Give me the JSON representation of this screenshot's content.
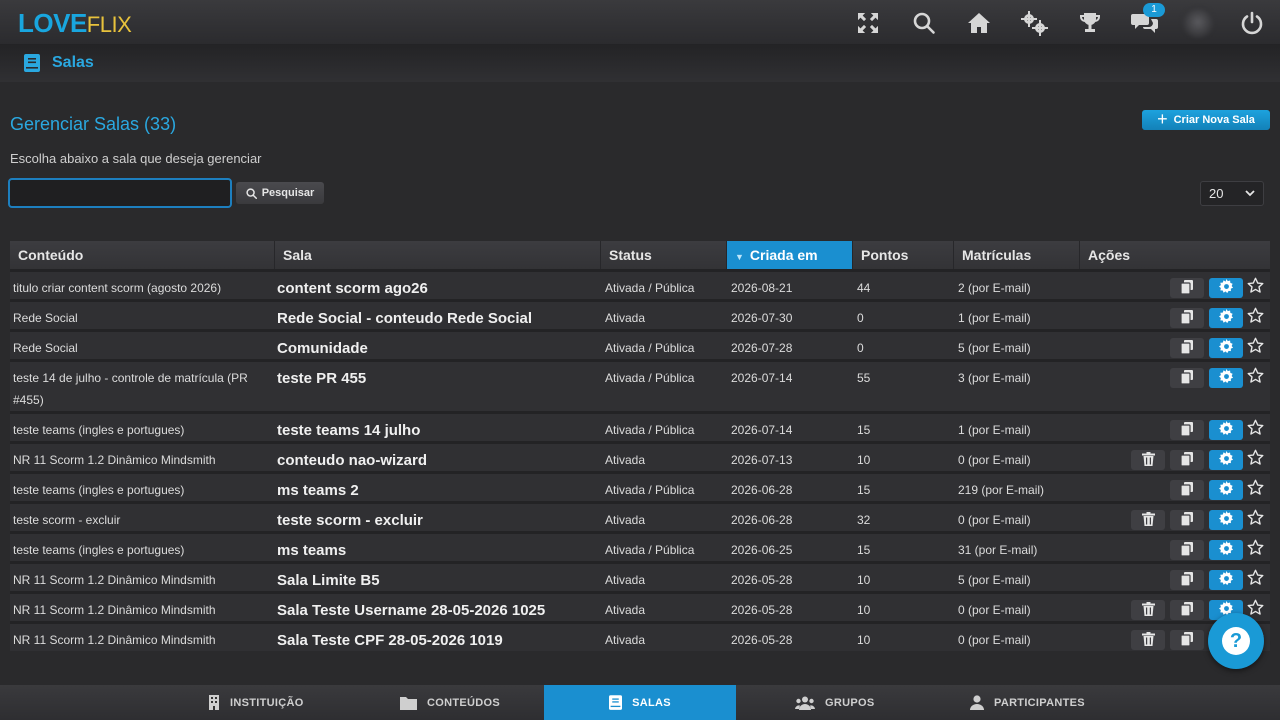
{
  "brand": {
    "part1": "LOVE",
    "part2": "FLIX"
  },
  "topbar": {
    "icons": [
      "expand-icon",
      "search-icon",
      "home-icon",
      "settings-icon",
      "trophy-icon",
      "chat-icon",
      "avatar",
      "power-icon"
    ],
    "chat_badge": "1"
  },
  "subheader": {
    "title": "Salas"
  },
  "main": {
    "title": "Gerenciar Salas (33)",
    "subtitle": "Escolha abaixo a sala que deseja gerenciar",
    "create_button": "Criar Nova Sala",
    "search": {
      "value": "",
      "placeholder": "",
      "button": "Pesquisar"
    },
    "page_size": "20"
  },
  "table": {
    "headers": [
      "Conteúdo",
      "Sala",
      "Status",
      "Criada em",
      "Pontos",
      "Matrículas",
      "Ações"
    ],
    "sorted_column": "Criada em",
    "rows": [
      {
        "conteudo": "titulo criar content scorm (agosto 2026)",
        "sala": "content scorm ago26",
        "status": "Ativada / Pública",
        "data": "2026-08-21",
        "pontos": "44",
        "matriculas": "2 (por E-mail)",
        "delete": false
      },
      {
        "conteudo": "Rede Social",
        "sala": "Rede Social - conteudo Rede Social",
        "status": "Ativada",
        "data": "2026-07-30",
        "pontos": "0",
        "matriculas": "1 (por E-mail)",
        "delete": false
      },
      {
        "conteudo": "Rede Social",
        "sala": "Comunidade",
        "status": "Ativada / Pública",
        "data": "2026-07-28",
        "pontos": "0",
        "matriculas": "5 (por E-mail)",
        "delete": false
      },
      {
        "conteudo": "teste 14 de julho - controle de matrícula (PR #455)",
        "sala": "teste PR 455",
        "status": "Ativada / Pública",
        "data": "2026-07-14",
        "pontos": "55",
        "matriculas": "3 (por E-mail)",
        "delete": false,
        "tall": true
      },
      {
        "conteudo": "teste teams (ingles e portugues)",
        "sala": "teste teams 14 julho",
        "status": "Ativada / Pública",
        "data": "2026-07-14",
        "pontos": "15",
        "matriculas": "1 (por E-mail)",
        "delete": false
      },
      {
        "conteudo": "NR 11 Scorm 1.2 Dinâmico Mindsmith",
        "sala": "conteudo nao-wizard",
        "status": "Ativada",
        "data": "2026-07-13",
        "pontos": "10",
        "matriculas": "0 (por E-mail)",
        "delete": true
      },
      {
        "conteudo": "teste teams (ingles e portugues)",
        "sala": "ms teams 2",
        "status": "Ativada / Pública",
        "data": "2026-06-28",
        "pontos": "15",
        "matriculas": "219 (por E-mail)",
        "delete": false
      },
      {
        "conteudo": "teste scorm - excluir",
        "sala": "teste scorm - excluir",
        "status": "Ativada",
        "data": "2026-06-28",
        "pontos": "32",
        "matriculas": "0 (por E-mail)",
        "delete": true
      },
      {
        "conteudo": "teste teams (ingles e portugues)",
        "sala": "ms teams",
        "status": "Ativada / Pública",
        "data": "2026-06-25",
        "pontos": "15",
        "matriculas": "31 (por E-mail)",
        "delete": false
      },
      {
        "conteudo": "NR 11 Scorm 1.2 Dinâmico Mindsmith",
        "sala": "Sala Limite B5",
        "status": "Ativada",
        "data": "2026-05-28",
        "pontos": "10",
        "matriculas": "5 (por E-mail)",
        "delete": false
      },
      {
        "conteudo": "NR 11 Scorm 1.2 Dinâmico Mindsmith",
        "sala": "Sala Teste Username 28-05-2026 1025",
        "status": "Ativada",
        "data": "2026-05-28",
        "pontos": "10",
        "matriculas": "0 (por E-mail)",
        "delete": true
      },
      {
        "conteudo": "NR 11 Scorm 1.2 Dinâmico Mindsmith",
        "sala": "Sala Teste CPF 28-05-2026 1019",
        "status": "Ativada",
        "data": "2026-05-28",
        "pontos": "10",
        "matriculas": "0 (por E-mail)",
        "delete": true
      }
    ]
  },
  "bottom_nav": [
    {
      "label": "INSTITUIÇÃO",
      "icon": "building-icon"
    },
    {
      "label": "CONTEÚDOS",
      "icon": "folder-icon"
    },
    {
      "label": "SALAS",
      "icon": "book-icon",
      "active": true
    },
    {
      "label": "GRUPOS",
      "icon": "group-icon"
    },
    {
      "label": "PARTICIPANTES",
      "icon": "user-icon"
    }
  ],
  "colors": {
    "accent": "#1a8fd0",
    "brand_blue": "#19a6df",
    "brand_gold": "#e8c23c",
    "background": "#2a2a2c"
  }
}
